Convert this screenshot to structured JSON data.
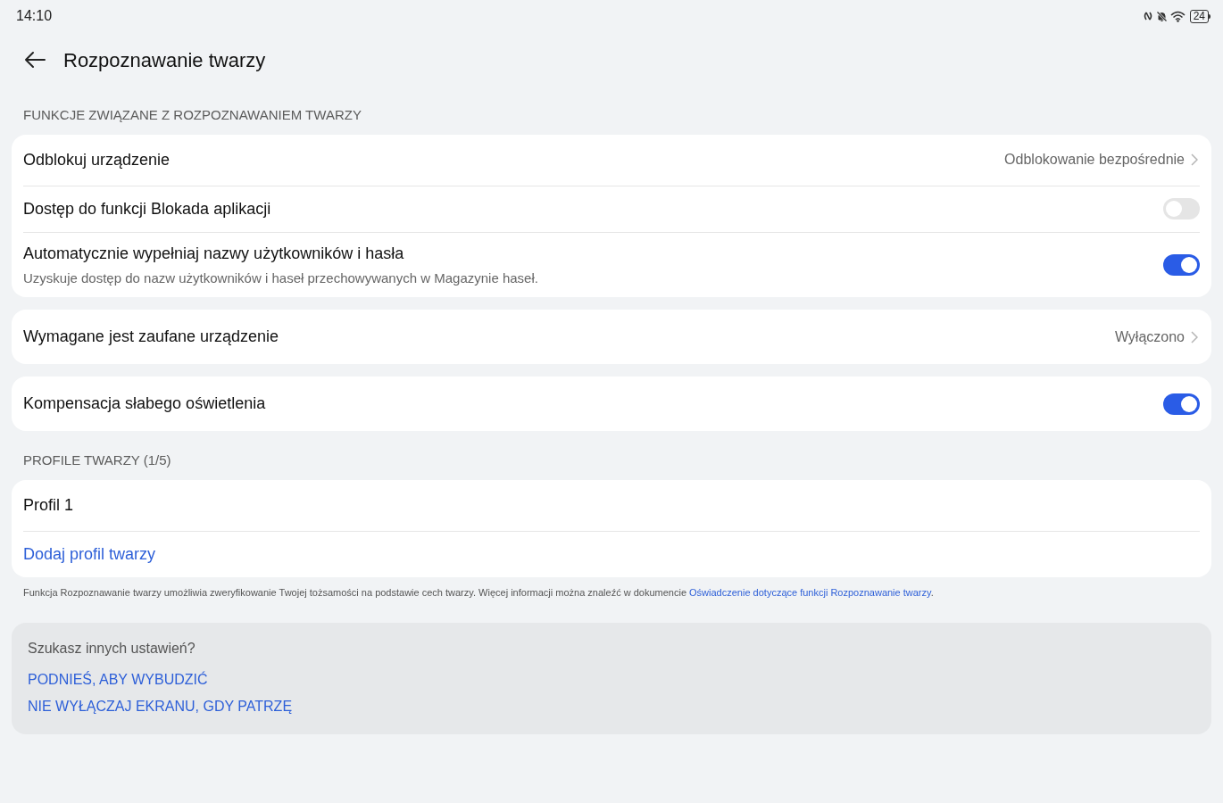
{
  "status_bar": {
    "time": "14:10",
    "battery": "24"
  },
  "header": {
    "title": "Rozpoznawanie twarzy"
  },
  "sections": [
    {
      "heading": "FUNKCJE ZWIĄZANE Z ROZPOZNAWANIEM TWARZY",
      "cards": [
        [
          {
            "kind": "link",
            "title": "Odblokuj urządzenie",
            "value": "Odblokowanie bezpośrednie"
          },
          {
            "kind": "switch",
            "title": "Dostęp do funkcji Blokada aplikacji",
            "on": false
          },
          {
            "kind": "switch",
            "title": "Automatycznie wypełniaj nazwy użytkowników i hasła",
            "subtitle": "Uzyskuje dostęp do nazw użytkowników i haseł przechowywanych w Magazynie haseł.",
            "on": true
          }
        ],
        [
          {
            "kind": "link",
            "title": "Wymagane jest zaufane urządzenie",
            "value": "Wyłączono"
          }
        ],
        [
          {
            "kind": "switch",
            "title": "Kompensacja słabego oświetlenia",
            "on": true
          }
        ]
      ]
    },
    {
      "heading": "PROFILE TWARZY (1/5)",
      "cards": [
        [
          {
            "kind": "plain",
            "title": "Profil 1"
          },
          {
            "kind": "action",
            "title": "Dodaj profil twarzy"
          }
        ]
      ]
    }
  ],
  "note": {
    "text": "Funkcja Rozpoznawanie twarzy umożliwia zweryfikowanie Twojej tożsamości na podstawie cech twarzy. Więcej informacji można znaleźć w dokumencie ",
    "link": "Oświadczenie dotyczące funkcji Rozpoznawanie twarzy",
    "end": "."
  },
  "suggestions": {
    "heading": "Szukasz innych ustawień?",
    "links": [
      "PODNIEŚ, ABY WYBUDZIĆ",
      "NIE WYŁĄCZAJ EKRANU, GDY PATRZĘ"
    ]
  }
}
